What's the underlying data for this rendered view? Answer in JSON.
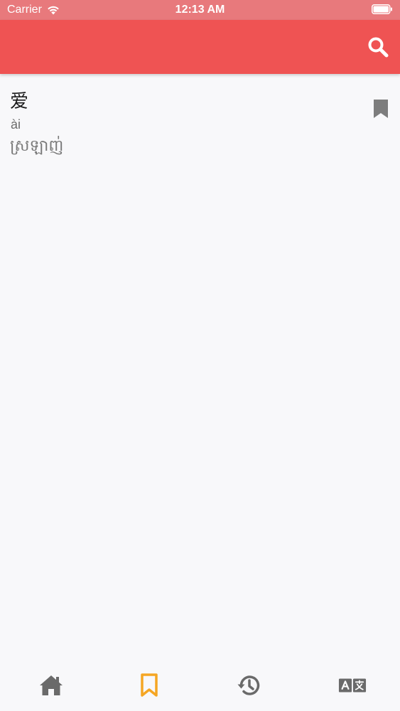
{
  "status_bar": {
    "carrier": "Carrier",
    "time": "12:13 AM"
  },
  "app_bar": {
    "background_color": "#ef5353",
    "search_icon": "search-icon"
  },
  "entries": [
    {
      "hanzi": "爱",
      "pinyin": "ài",
      "translation": "ស្រឡាញ់",
      "bookmarked": true
    }
  ],
  "bottom_nav": {
    "items": [
      {
        "icon": "home-icon",
        "active": false
      },
      {
        "icon": "bookmark-icon",
        "active": true
      },
      {
        "icon": "history-icon",
        "active": false
      },
      {
        "icon": "translate-icon",
        "active": false
      }
    ],
    "active_color": "#f5a623",
    "inactive_color": "#6a6a6a"
  }
}
